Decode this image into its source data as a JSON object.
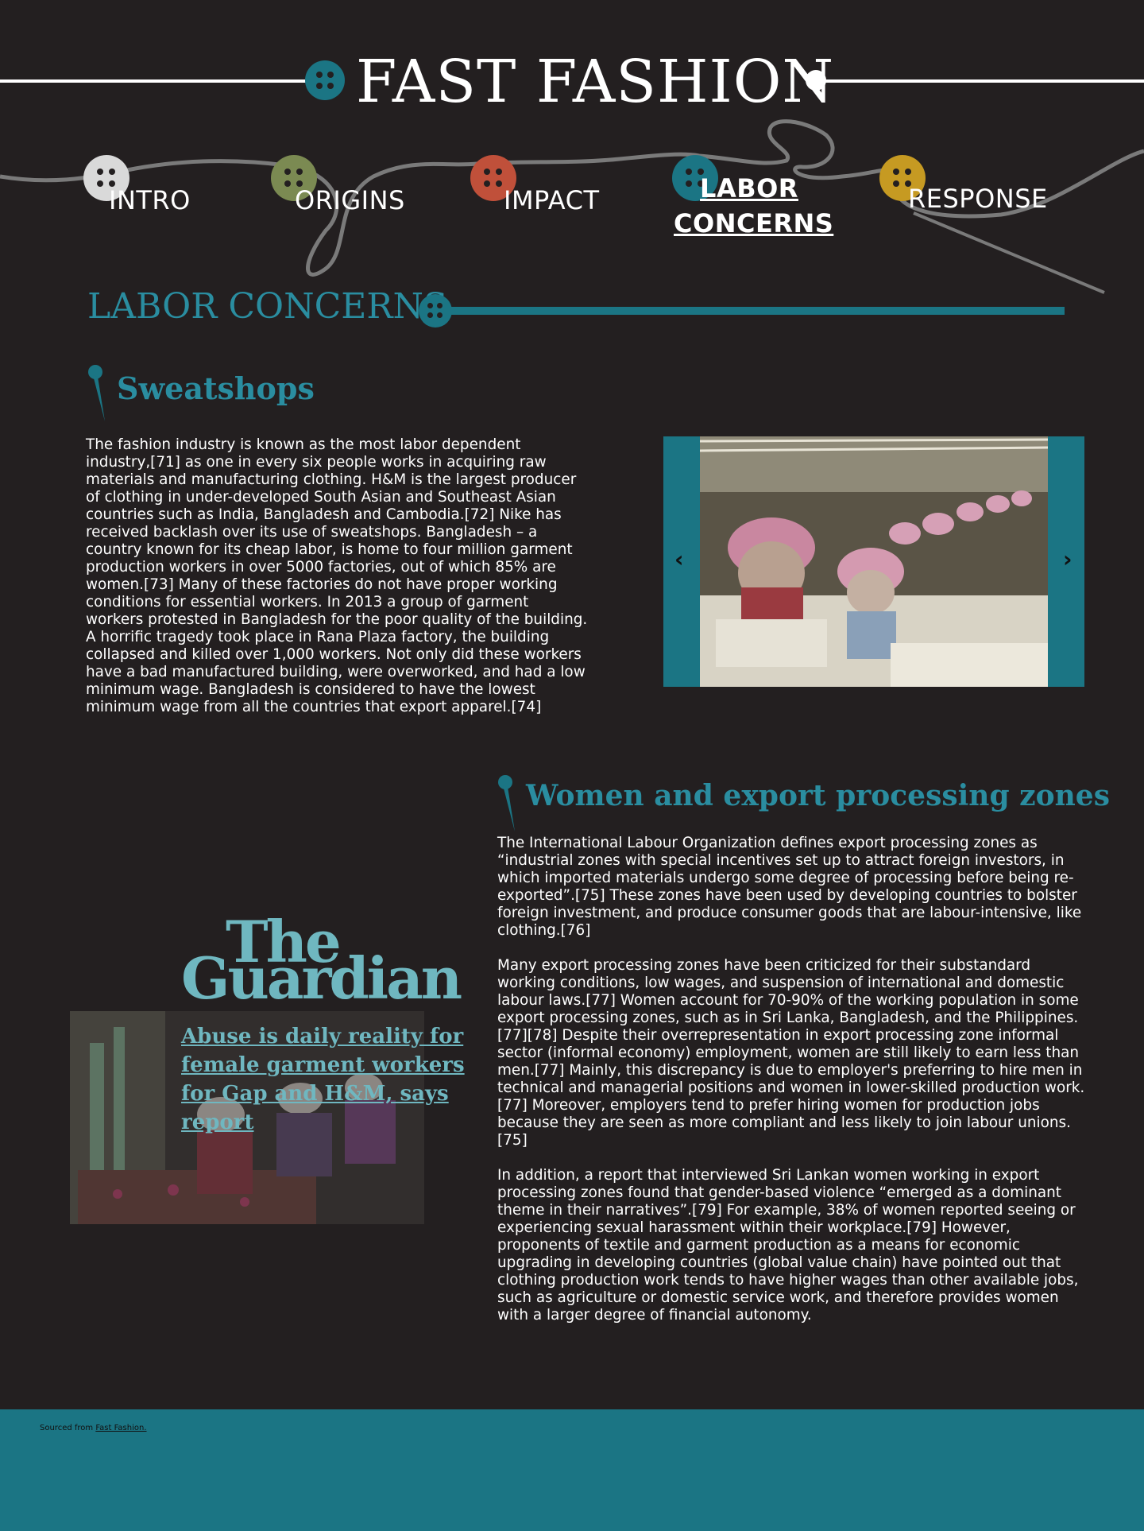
{
  "header": {
    "title": "FAST FASHION"
  },
  "nav": {
    "items": [
      {
        "label": "INTRO",
        "color": "#d9d9d9"
      },
      {
        "label": "ORIGINS",
        "color": "#7b8a52"
      },
      {
        "label": "IMPACT",
        "color": "#c0503a"
      },
      {
        "label": "LABOR CONCERNS",
        "label_line1": "LABOR",
        "label_line2": "CONCERNS",
        "color": "#1b7584",
        "active": true
      },
      {
        "label": "RESPONSE",
        "color": "#c69a22"
      }
    ]
  },
  "section": {
    "title": "LABOR CONCERNS",
    "accent_color": "#1b7584"
  },
  "sweatshops": {
    "heading": "Sweatshops",
    "body": "The fashion industry is known as the most labor dependent industry,[71] as one in every six people works in acquiring raw materials and manufacturing clothing. H&M is the largest producer of clothing in under-developed South Asian and Southeast Asian countries such as India, Bangladesh and Cambodia.[72] Nike has received backlash over its use of sweatshops. Bangladesh – a country known for its cheap labor, is home to four million garment production workers in over 5000 factories, out of which 85% are women.[73] Many of these factories do not have proper working conditions for essential workers. In 2013 a group of garment workers protested in Bangladesh for the poor quality of the building. A horrific tragedy took place in Rana Plaza factory, the building collapsed and killed over 1,000 workers. Not only did these workers have a bad manufactured building, were overworked, and had a low minimum wage. Bangladesh is considered to have the lowest minimum wage from all the countries that export apparel.[74]",
    "carousel": {
      "prev_icon": "chevron-left-icon",
      "next_icon": "chevron-right-icon",
      "prev_glyph": "‹",
      "next_glyph": "›"
    }
  },
  "epz": {
    "heading": "Women and export processing zones",
    "paragraphs": [
      "The International Labour Organization defines export processing zones as “industrial zones with special incentives set up to attract foreign investors, in which imported materials undergo some degree of processing before being re-exported”.[75] These zones have been used by developing countries to bolster foreign investment, and produce consumer goods that are labour-intensive, like clothing.[76]",
      "Many export processing zones have been criticized for their substandard working conditions, low wages, and suspension of international and domestic labour laws.[77] Women account for 70-90% of the working population in some export processing zones, such as in Sri Lanka, Bangladesh, and the Philippines.[77][78] Despite their overrepresentation in export processing zone informal sector (informal economy) employment, women are still likely to earn less than men.[77] Mainly, this discrepancy is due to employer's preferring to hire men in technical and managerial positions and women in lower-skilled production work.[77] Moreover, employers tend to prefer hiring women for production jobs because they are seen as more compliant and less likely to join labour unions.[75]",
      "In addition, a report that interviewed Sri Lankan women working in export processing zones found that gender-based violence “emerged as a dominant theme in their narratives”.[79] For example, 38% of women reported seeing or experiencing sexual harassment within their workplace.[79] However, proponents of textile and garment production as a means for economic upgrading in developing countries (global value chain) have pointed out that clothing production work tends to have higher wages than other available jobs, such as agriculture or domestic service work, and therefore provides women with a larger degree of financial autonomy."
    ]
  },
  "guardian": {
    "logo_line1": "The",
    "logo_line2": "Guardian",
    "headline": "Abuse is daily reality for female garment workers for Gap and H&M, says report"
  },
  "footer": {
    "prefix": "Sourced from ",
    "link": "Fast Fashion."
  }
}
